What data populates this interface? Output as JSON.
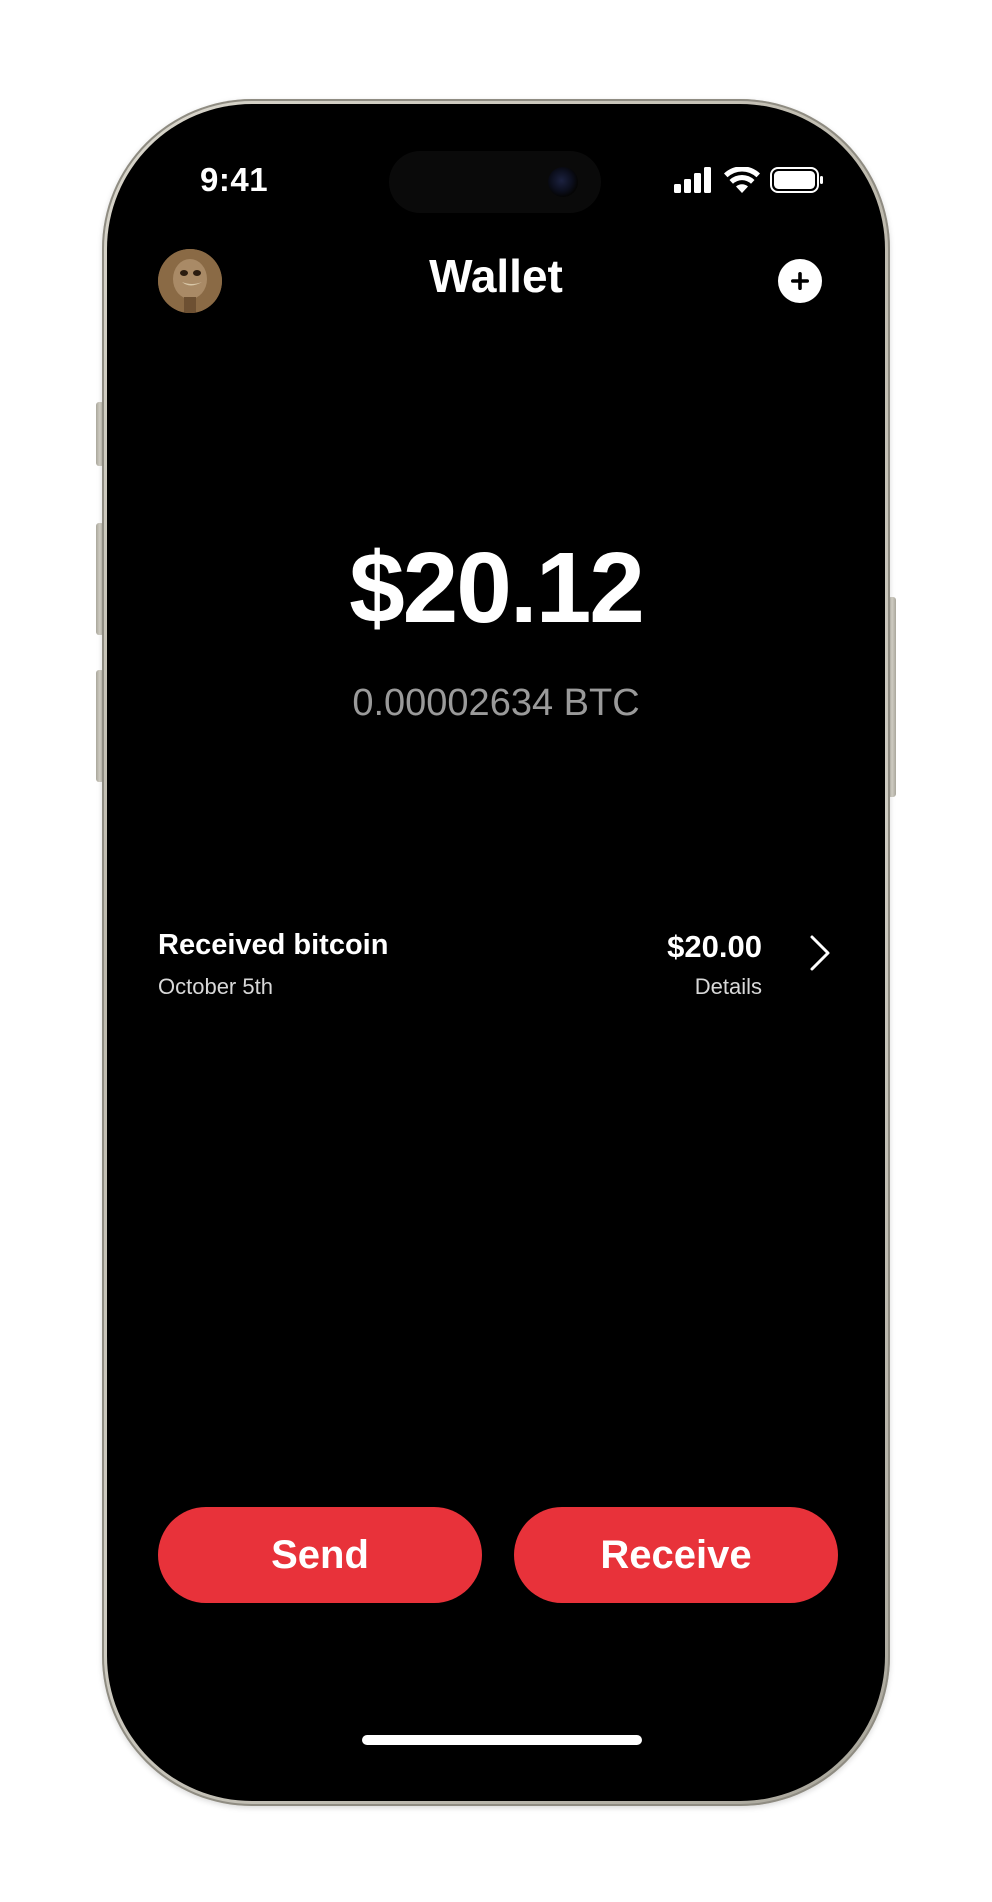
{
  "status_bar": {
    "time": "9:41"
  },
  "header": {
    "title": "Wallet",
    "avatar_icon": "ostrich-avatar",
    "add_icon": "plus-circle-icon"
  },
  "balance": {
    "usd": "$20.12",
    "btc": "0.00002634 BTC"
  },
  "transactions": [
    {
      "title": "Received bitcoin",
      "date": "October 5th",
      "amount": "$20.00",
      "details_label": "Details"
    }
  ],
  "actions": {
    "send_label": "Send",
    "receive_label": "Receive"
  },
  "colors": {
    "accent": "#e8323a",
    "background": "#000000",
    "secondary_text": "#9a9a9a"
  }
}
